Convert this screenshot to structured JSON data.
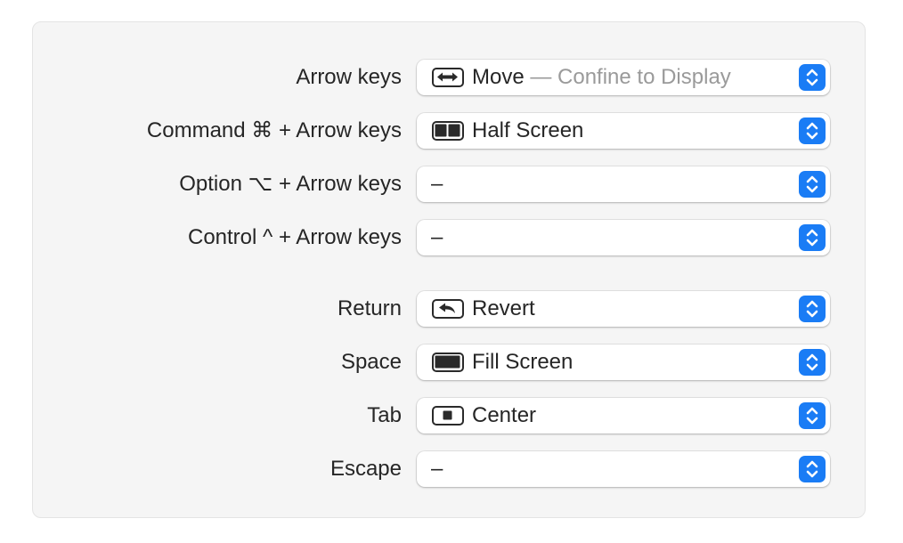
{
  "rows": [
    {
      "label": "Arrow keys",
      "value": "Move",
      "sub": " — Confine to Display",
      "icon": "move-arrows-icon"
    },
    {
      "label": "Command ⌘ + Arrow keys",
      "value": "Half Screen",
      "sub": "",
      "icon": "half-screen-icon"
    },
    {
      "label": "Option ⌥ + Arrow keys",
      "value": "–",
      "sub": "",
      "icon": ""
    },
    {
      "label": "Control ^ + Arrow keys",
      "value": "–",
      "sub": "",
      "icon": ""
    },
    {
      "label": "Return",
      "value": "Revert",
      "sub": "",
      "icon": "revert-icon"
    },
    {
      "label": "Space",
      "value": "Fill Screen",
      "sub": "",
      "icon": "fill-screen-icon"
    },
    {
      "label": "Tab",
      "value": "Center",
      "sub": "",
      "icon": "center-icon"
    },
    {
      "label": "Escape",
      "value": "–",
      "sub": "",
      "icon": ""
    }
  ],
  "colors": {
    "accent": "#1a7cf5",
    "panel": "#f5f5f5",
    "text": "#262626",
    "secondary": "#9a9a9a"
  }
}
